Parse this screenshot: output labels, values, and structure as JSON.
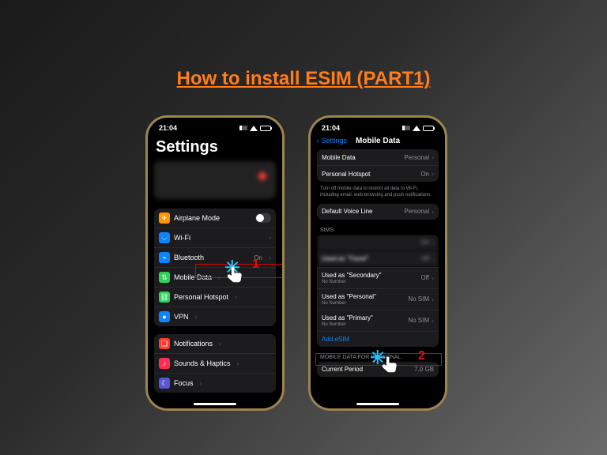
{
  "page": {
    "title": "How to install ESIM (PART1)"
  },
  "callouts": {
    "step1": "1",
    "step2": "2"
  },
  "phone_left": {
    "time": "21:04",
    "header": "Settings",
    "group1": [
      {
        "icon": "airplane-icon",
        "bg": "#ff9500",
        "label": "Airplane Mode",
        "toggle": true
      },
      {
        "icon": "wifi-icon",
        "bg": "#0a84ff",
        "label": "Wi-Fi",
        "value": ""
      },
      {
        "icon": "bluetooth-icon",
        "bg": "#0a84ff",
        "label": "Bluetooth",
        "value": "On"
      },
      {
        "icon": "antenna-icon",
        "bg": "#30d158",
        "label": "Mobile Data",
        "value": "",
        "highlight": true
      },
      {
        "icon": "link-icon",
        "bg": "#30d158",
        "label": "Personal Hotspot",
        "value": ""
      },
      {
        "icon": "globe-icon",
        "bg": "#0a84ff",
        "label": "VPN",
        "value": ""
      }
    ],
    "group2": [
      {
        "icon": "bell-icon",
        "bg": "#ff3b30",
        "label": "Notifications"
      },
      {
        "icon": "speaker-icon",
        "bg": "#ff2d55",
        "label": "Sounds & Haptics"
      },
      {
        "icon": "moon-icon",
        "bg": "#5856d6",
        "label": "Focus"
      }
    ]
  },
  "phone_right": {
    "time": "21:04",
    "back": "Settings",
    "title": "Mobile Data",
    "g1": [
      {
        "label": "Mobile Data",
        "value": "Personal"
      },
      {
        "label": "Personal Hotspot",
        "value": "On"
      }
    ],
    "note": "Turn off mobile data to restrict all data to Wi-Fi, including email, web browsing and push notifications.",
    "g2": [
      {
        "label": "Default Voice Line",
        "value": "Personal"
      }
    ],
    "sims_header": "SIMs",
    "sims": [
      {
        "label": "",
        "sub": "",
        "value": "On",
        "blur": true
      },
      {
        "label": "Used as \"Travel\"",
        "sub": "",
        "value": "Off",
        "blur": true
      },
      {
        "label": "Used as \"Secondary\"",
        "sub": "No Number",
        "value": "Off"
      },
      {
        "label": "Used as \"Personal\"",
        "sub": "No Number",
        "value": "No SIM"
      },
      {
        "label": "Used as \"Primary\"",
        "sub": "No Number",
        "value": "No SIM"
      }
    ],
    "add_esim": "Add eSIM",
    "section2": "MOBILE DATA FOR PERSONAL",
    "period": {
      "label": "Current Period",
      "value": "7.0 GB"
    }
  }
}
